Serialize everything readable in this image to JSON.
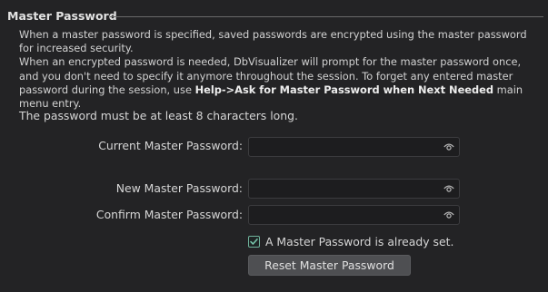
{
  "section": {
    "title": "Master Password"
  },
  "description": {
    "line1": "When a master password is specified, saved passwords are encrypted using the master password for increased security.",
    "line2_prefix": "When an encrypted password is needed, DbVisualizer will prompt for the master password once, and you don't need to specify it anymore throughout the session. To forget any entered master password during the session, use ",
    "line2_bold": "Help->Ask for Master Password when Next Needed",
    "line2_suffix": " main menu entry."
  },
  "requirement_text": "The password must be at least 8 characters long.",
  "fields": {
    "current": {
      "label": "Current Master Password:",
      "value": "",
      "icon": "eye-icon"
    },
    "new": {
      "label": "New Master Password:",
      "value": "",
      "icon": "eye-icon"
    },
    "confirm": {
      "label": "Confirm Master Password:",
      "value": "",
      "icon": "eye-icon"
    }
  },
  "already_set": {
    "label": "A Master Password is already set.",
    "checked": true
  },
  "reset_button": {
    "label": "Reset Master Password"
  },
  "colors": {
    "background": "#232325",
    "check_accent": "#6fb39c",
    "button_bg": "#4e4f52"
  }
}
